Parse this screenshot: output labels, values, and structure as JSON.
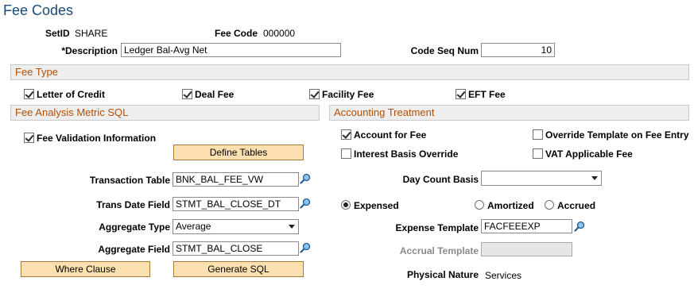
{
  "page_title": "Fee Codes",
  "header": {
    "setid_label": "SetID",
    "setid_value": "SHARE",
    "feecode_label": "Fee Code",
    "feecode_value": "000000",
    "description_label": "*Description",
    "description_value": "Ledger Bal-Avg Net",
    "codeseq_label": "Code Seq Num",
    "codeseq_value": "10"
  },
  "fee_type": {
    "title": "Fee Type",
    "items": [
      {
        "label": "Letter of Credit",
        "checked": true
      },
      {
        "label": "Deal Fee",
        "checked": true
      },
      {
        "label": "Facility Fee",
        "checked": true
      },
      {
        "label": "EFT Fee",
        "checked": true
      }
    ]
  },
  "fee_analysis": {
    "title": "Fee Analysis Metric SQL",
    "fee_validation_label": "Fee Validation Information",
    "define_tables_label": "Define Tables",
    "transaction_table_label": "Transaction Table",
    "transaction_table_value": "BNK_BAL_FEE_VW",
    "trans_date_label": "Trans Date Field",
    "trans_date_value": "STMT_BAL_CLOSE_DT",
    "aggregate_type_label": "Aggregate Type",
    "aggregate_type_value": "Average",
    "aggregate_field_label": "Aggregate Field",
    "aggregate_field_value": "STMT_BAL_CLOSE",
    "where_clause_label": "Where Clause",
    "generate_sql_label": "Generate SQL"
  },
  "accounting": {
    "title": "Accounting Treatment",
    "account_for_fee_label": "Account for Fee",
    "override_template_label": "Override Template on Fee Entry",
    "interest_basis_label": "Interest Basis Override",
    "vat_label": "VAT Applicable Fee",
    "day_count_label": "Day Count Basis",
    "day_count_value": "",
    "radio_expensed": "Expensed",
    "radio_amortized": "Amortized",
    "radio_accrued": "Accrued",
    "expense_template_label": "Expense Template",
    "expense_template_value": "FACFEEEXP",
    "accrual_template_label": "Accrual Template",
    "accrual_template_value": "",
    "physical_nature_label": "Physical Nature",
    "physical_nature_value": "Services"
  },
  "colors": {
    "title_blue": "#1a4a7a",
    "section_orange": "#b34f00",
    "button_bg": "#fde0b0"
  }
}
